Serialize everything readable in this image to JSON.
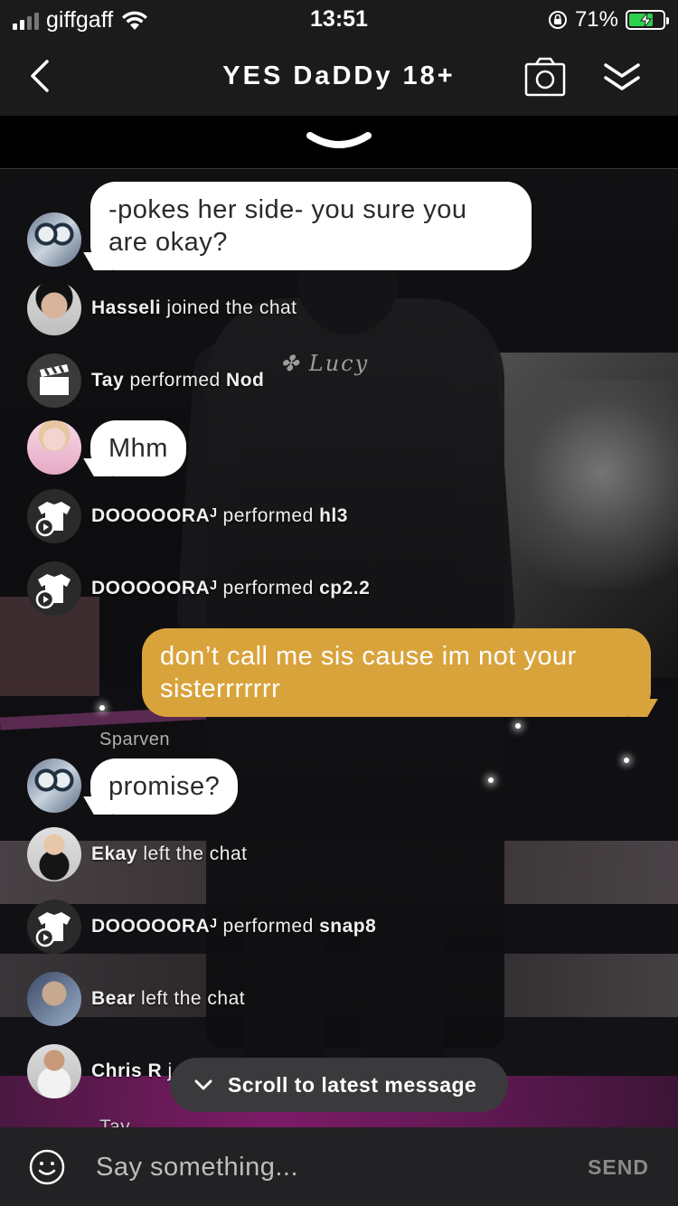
{
  "status_bar": {
    "carrier": "giffgaff",
    "time": "13:51",
    "battery_percent": "71%",
    "battery_level": 0.71,
    "battery_color": "#2bd04d"
  },
  "header": {
    "title": "YES DaDDy 18+",
    "back_icon": "chevron-left-icon",
    "camera_icon": "camera-icon",
    "collapse_icon": "double-chevron-down-icon"
  },
  "scene": {
    "watermark": "Lucy"
  },
  "messages": [
    {
      "type": "bubble",
      "text": "-pokes her side- you sure you are okay?"
    },
    {
      "type": "event",
      "user": "Hasseli",
      "action": "joined the chat"
    },
    {
      "type": "event",
      "user": "Tay",
      "action": "performed",
      "target": "Nod"
    },
    {
      "type": "bubble",
      "text": "Mhm"
    },
    {
      "type": "event",
      "user": "DOOOOORAᴶ",
      "action": "performed",
      "target": "hl3"
    },
    {
      "type": "event",
      "user": "DOOOOORAᴶ",
      "action": "performed",
      "target": "cp2.2"
    },
    {
      "type": "bubble_mine",
      "text": "don’t call me sis cause im not your sisterrrrrrr"
    },
    {
      "type": "sender",
      "text": "Sparven"
    },
    {
      "type": "bubble",
      "text": "promise?"
    },
    {
      "type": "event",
      "user": "Ekay",
      "action": "left the chat"
    },
    {
      "type": "event",
      "user": "DOOOOORAᴶ",
      "action": "performed",
      "target": "snap8"
    },
    {
      "type": "event",
      "user": "Bear",
      "action": "left the chat"
    },
    {
      "type": "event",
      "user": "Chris R",
      "action": "j"
    },
    {
      "type": "event_partial",
      "text": "Tay"
    }
  ],
  "scroll_pill": {
    "label": "Scroll to latest message"
  },
  "composer": {
    "placeholder": "Say something...",
    "send_label": "SEND"
  },
  "colors": {
    "accent_mine": "#d9a33c",
    "bar_background": "#1b1b1c"
  }
}
